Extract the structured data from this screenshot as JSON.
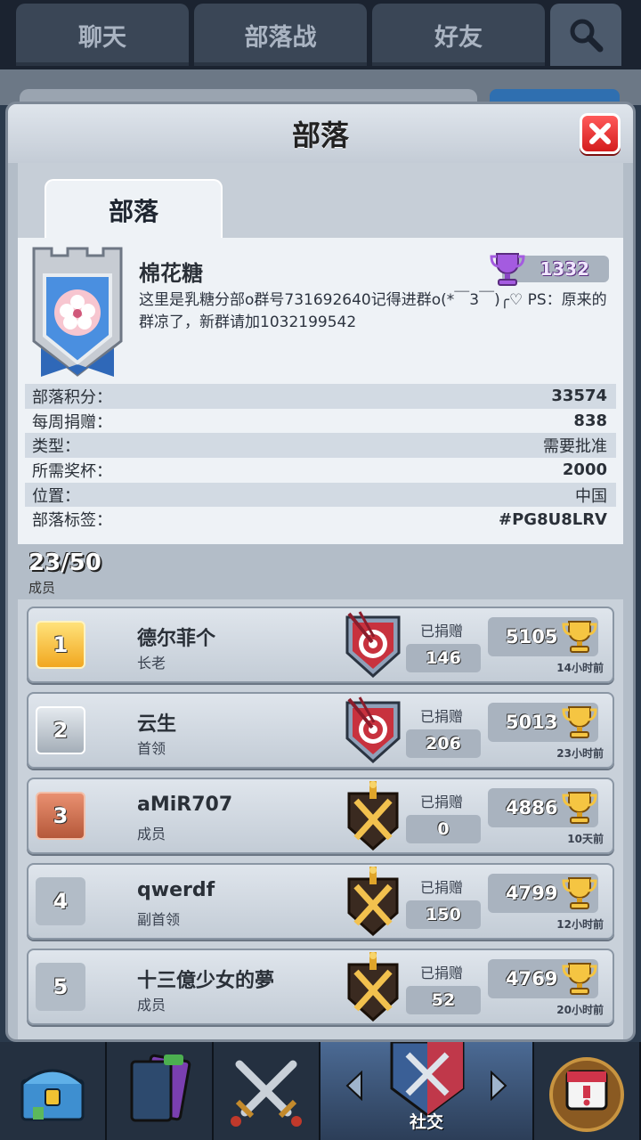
{
  "top_tabs": [
    "聊天",
    "部落战",
    "好友"
  ],
  "modal": {
    "title": "部落",
    "tab": "部落"
  },
  "clan": {
    "name": "棉花糖",
    "trophies": "1332",
    "description": "这里是乳糖分部o群号731692640记得进群o(*￣3￣)╭♡ PS：原来的群凉了，新群请加1032199542"
  },
  "stats": [
    {
      "label": "部落积分：",
      "value": "33574"
    },
    {
      "label": "每周捐赠：",
      "value": "838"
    },
    {
      "label": "类型：",
      "value": "需要批准"
    },
    {
      "label": "所需奖杯：",
      "value": "2000"
    },
    {
      "label": "位置：",
      "value": "中国"
    },
    {
      "label": "部落标签：",
      "value": "#PG8U8LRV"
    }
  ],
  "members_summary": {
    "count": "23/50",
    "label": "成员"
  },
  "donated_label": "已捐赠",
  "members": [
    {
      "rank": "1",
      "name": "德尔菲个",
      "role": "长老",
      "donated": "146",
      "trophies": "5105",
      "last_seen": "14小时前",
      "rank_style": "gold",
      "badge": "target-badge-icon"
    },
    {
      "rank": "2",
      "name": "云生",
      "role": "首领",
      "donated": "206",
      "trophies": "5013",
      "last_seen": "23小时前",
      "rank_style": "silver",
      "badge": "target-badge-icon"
    },
    {
      "rank": "3",
      "name": "aMiR707",
      "role": "成员",
      "donated": "0",
      "trophies": "4886",
      "last_seen": "10天前",
      "rank_style": "bronze",
      "badge": "crossed-swords-badge-icon"
    },
    {
      "rank": "4",
      "name": "qwerdf",
      "role": "副首领",
      "donated": "150",
      "trophies": "4799",
      "last_seen": "12小时前",
      "rank_style": "plain",
      "badge": "crossed-swords-badge-icon"
    },
    {
      "rank": "5",
      "name": "十三億少女的夢",
      "role": "成员",
      "donated": "52",
      "trophies": "4769",
      "last_seen": "20小时前",
      "rank_style": "plain",
      "badge": "crossed-swords-badge-icon"
    }
  ],
  "bottom_nav": {
    "active_label": "社交"
  }
}
